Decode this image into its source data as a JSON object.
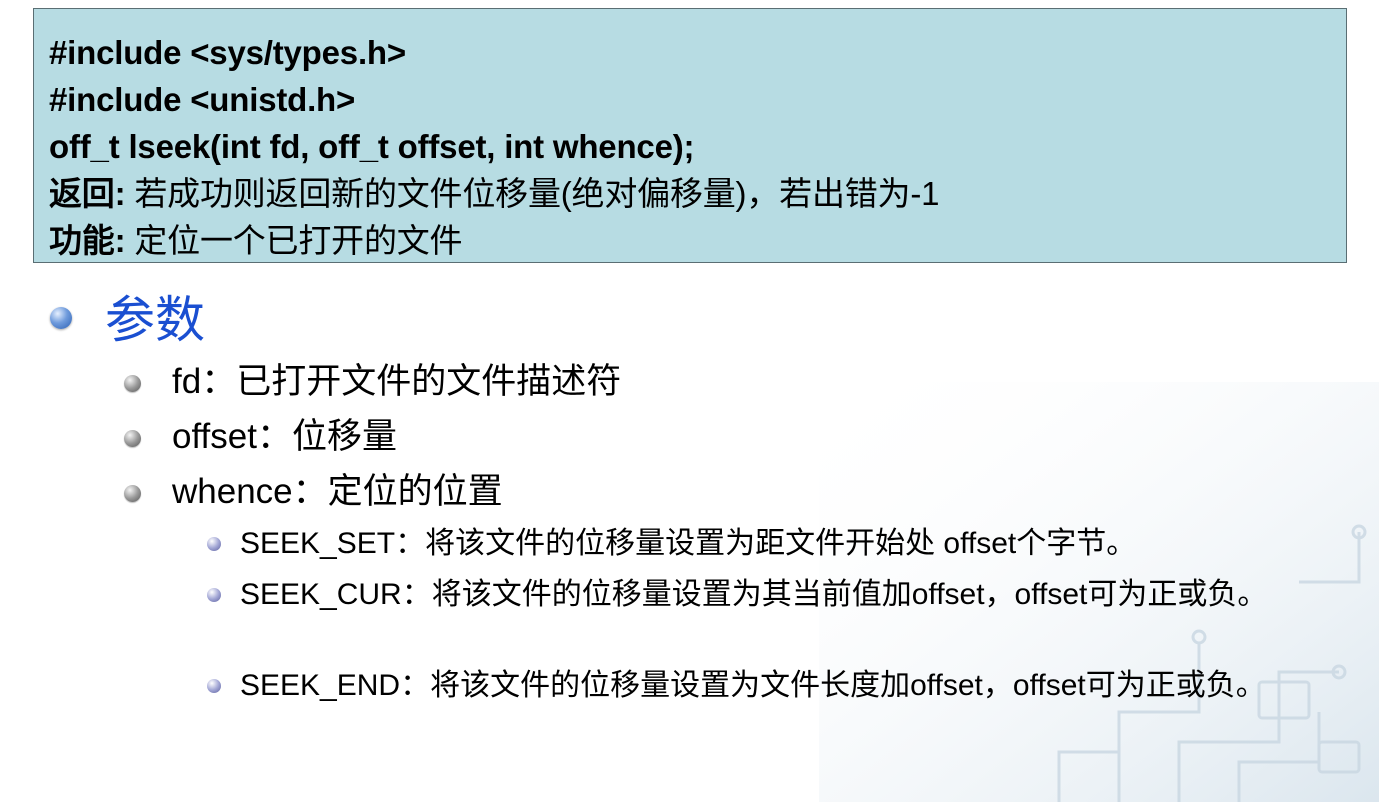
{
  "code_box": {
    "lines": [
      "#include <sys/types.h>",
      "#include <unistd.h>",
      "off_t lseek(int fd, off_t offset, int whence);"
    ],
    "return_label": "返回:",
    "return_text": " 若成功则返回新的文件位移量(绝对偏移量)，若出错为-1",
    "function_label": "功能:",
    "function_text": " 定位一个已打开的文件"
  },
  "section": {
    "title": "参数",
    "params": [
      "fd：已打开文件的文件描述符",
      "offset：位移量",
      "whence：定位的位置"
    ],
    "whence_options": [
      "SEEK_SET：将该文件的位移量设置为距文件开始处 offset个字节。",
      "SEEK_CUR：将该文件的位移量设置为其当前值加offset，offset可为正或负。",
      "SEEK_END：将该文件的位移量设置为文件长度加offset，offset可为正或负。"
    ]
  },
  "colors": {
    "code_box_bg": "#b7dce3",
    "title_blue": "#1a4fd1"
  }
}
